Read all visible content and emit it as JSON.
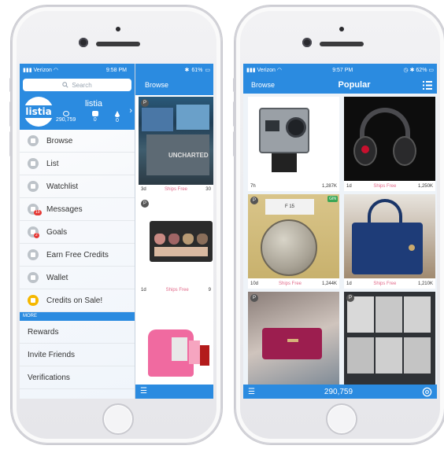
{
  "left_phone": {
    "status": {
      "carrier": "Verizon",
      "time": "9:58 PM",
      "battery": "61%"
    },
    "search_placeholder": "Search",
    "profile": {
      "logo": "listia",
      "username": "listia",
      "credits": "290,759",
      "stat2": "0",
      "stat3": "0"
    },
    "menu_items": [
      {
        "label": "Browse",
        "icon": "glasses-icon"
      },
      {
        "label": "List",
        "icon": "camera-icon"
      },
      {
        "label": "Watchlist",
        "icon": "mask-icon"
      },
      {
        "label": "Messages",
        "icon": "messages-icon",
        "badge": "19"
      },
      {
        "label": "Goals",
        "icon": "target-icon",
        "badge": "2"
      },
      {
        "label": "Earn Free Credits",
        "icon": "megaphone-icon"
      },
      {
        "label": "Wallet",
        "icon": "wallet-icon"
      },
      {
        "label": "Credits on Sale!",
        "icon": "star-icon"
      }
    ],
    "more_label": "MORE",
    "more_items": [
      "Rewards",
      "Invite Friends",
      "Verifications"
    ],
    "browse_panel": {
      "title": "Browse",
      "items": [
        {
          "time": "3d",
          "shipping": "Ships Free",
          "price": "30",
          "title_text": "UNCHARTED"
        },
        {
          "time": "1d",
          "shipping": "Ships Free",
          "price": "9"
        }
      ]
    }
  },
  "right_phone": {
    "status": {
      "carrier": "Verizon",
      "time": "9:57 PM",
      "battery": "62%"
    },
    "nav": {
      "back": "Browse",
      "title": "Popular"
    },
    "items": [
      {
        "time": "7h",
        "shipping": "",
        "price": "1,287K",
        "image": "action-camera"
      },
      {
        "time": "1d",
        "shipping": "Ships Free",
        "price": "1,250K",
        "image": "headphones"
      },
      {
        "time": "10d",
        "shipping": "Ships Free",
        "price": "1,244K",
        "image": "coin",
        "grade": "GIN",
        "slab_text": "F 15"
      },
      {
        "time": "1d",
        "shipping": "Ships Free",
        "price": "1,210K",
        "image": "handbag"
      },
      {
        "image": "wallet"
      },
      {
        "image": "cards"
      }
    ],
    "bottom_credits": "290,759"
  },
  "colors": {
    "brand_blue": "#2b8be0",
    "ships_free": "#e26a8a"
  }
}
